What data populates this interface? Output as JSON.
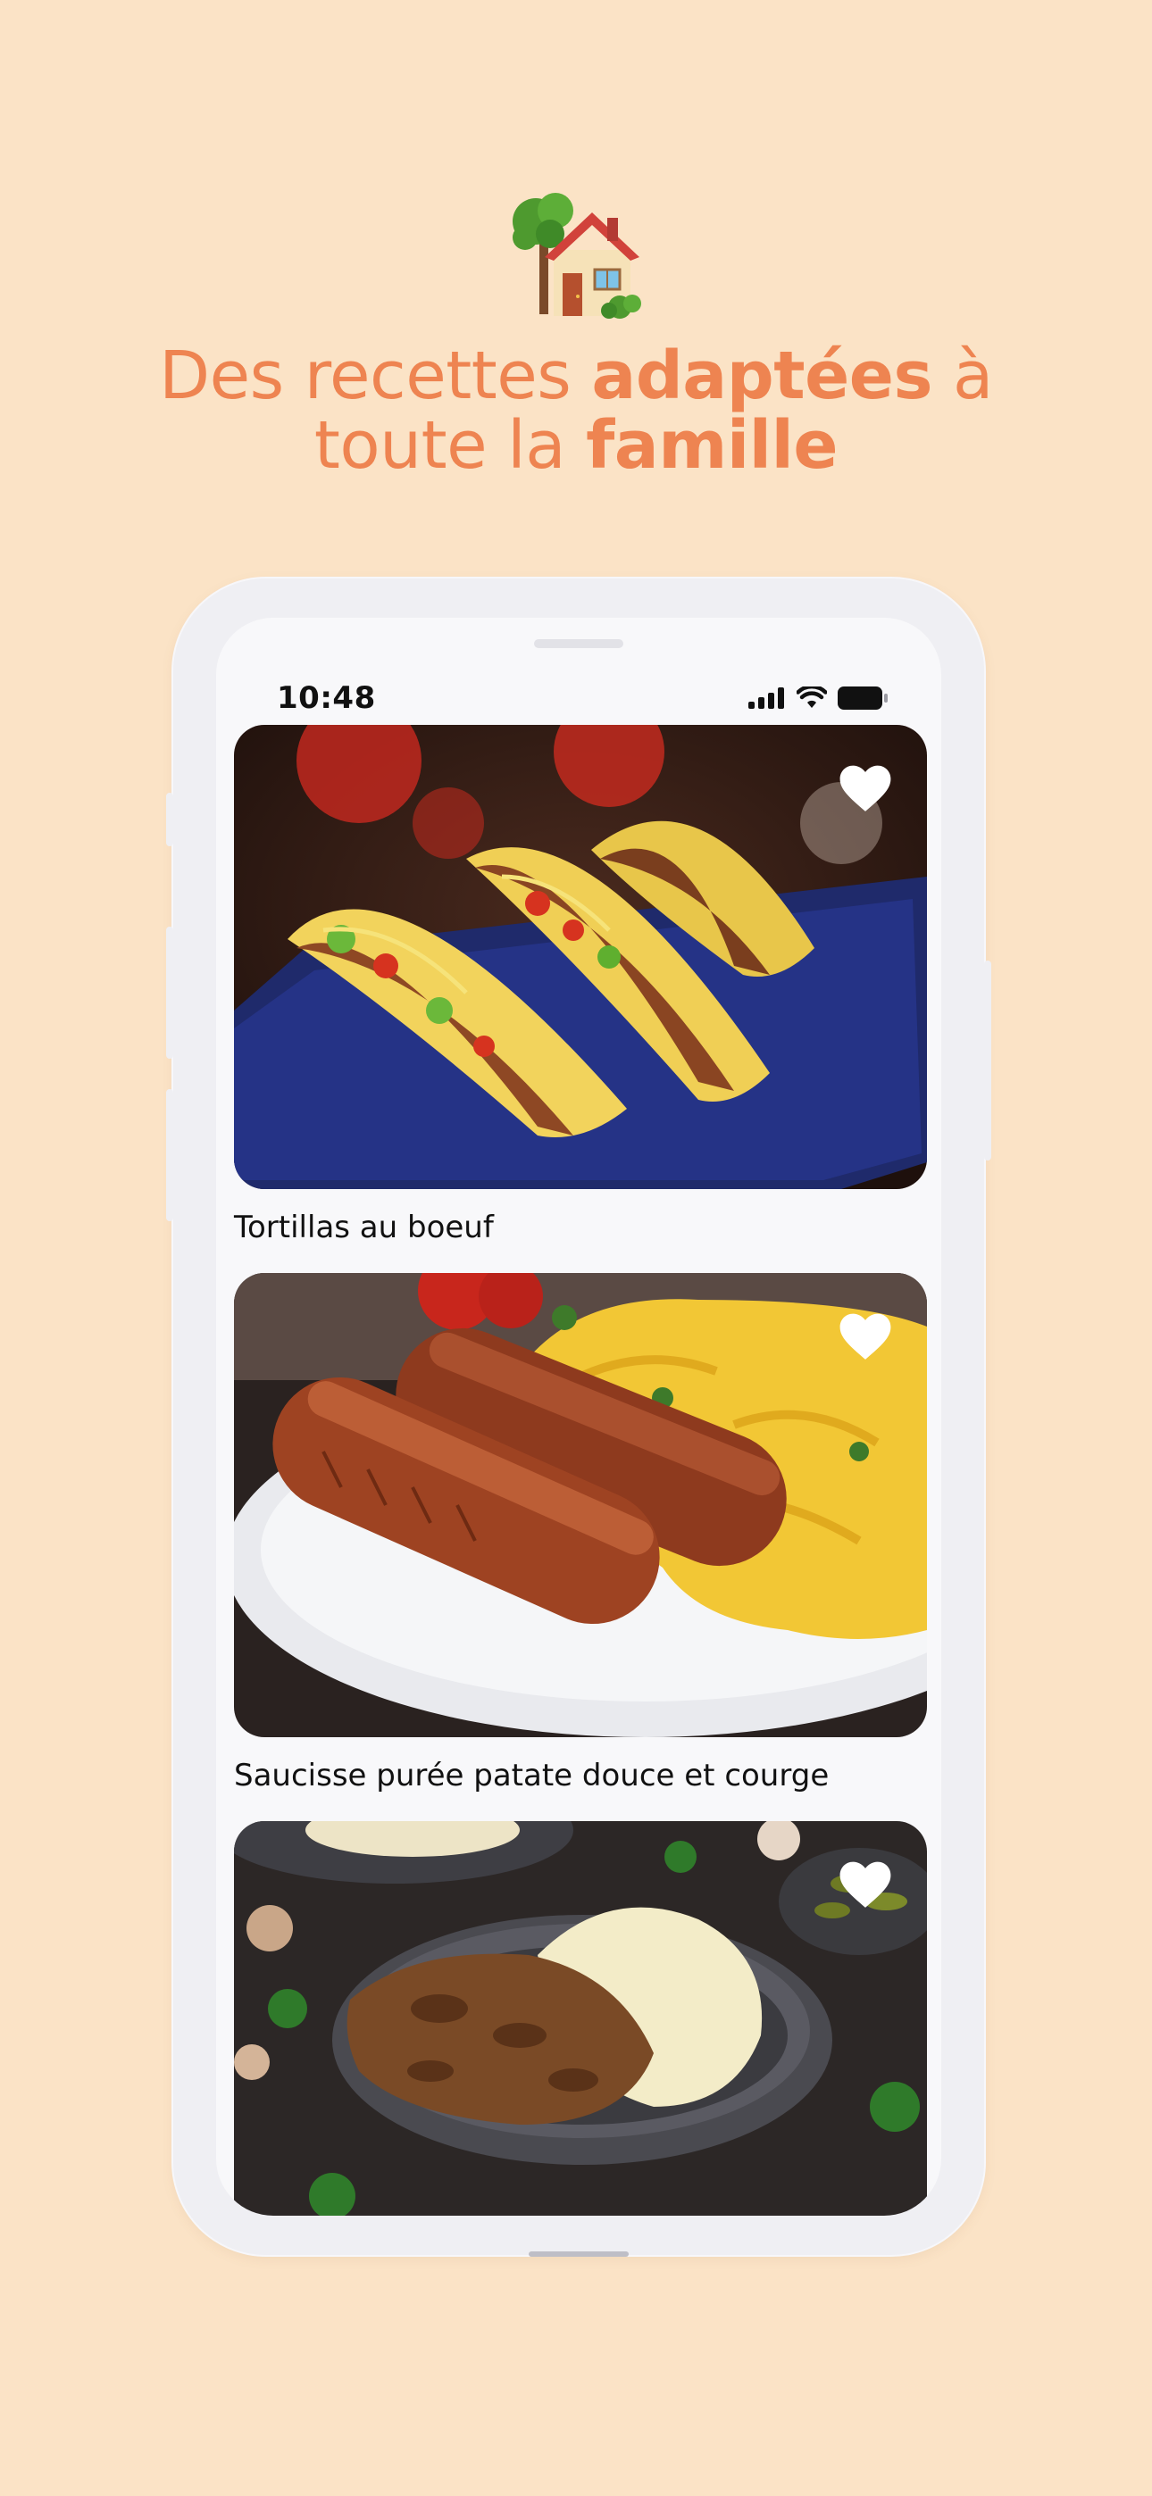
{
  "hero": {
    "icon": "house-with-garden-icon",
    "headline_parts": [
      {
        "text": "Des recettes ",
        "bold": false
      },
      {
        "text": "adaptées",
        "bold": true
      },
      {
        "text": " à",
        "bold": false
      },
      {
        "text": "toute la ",
        "bold": false
      },
      {
        "text": "famille",
        "bold": true
      }
    ]
  },
  "status_bar": {
    "time": "10:48",
    "icons": [
      "cellular-signal-icon",
      "wifi-icon",
      "battery-icon"
    ]
  },
  "recipes": [
    {
      "title": "Tortillas au boeuf",
      "favorite_icon": "heart-icon"
    },
    {
      "title": "Saucisse purée patate douce et courge",
      "favorite_icon": "heart-icon"
    },
    {
      "title": "",
      "favorite_icon": "heart-icon"
    }
  ],
  "colors": {
    "background": "#FBE3C6",
    "accent": "#EE8451",
    "phone_frame": "#EFEFF3",
    "screen": "#F8F8FA"
  }
}
